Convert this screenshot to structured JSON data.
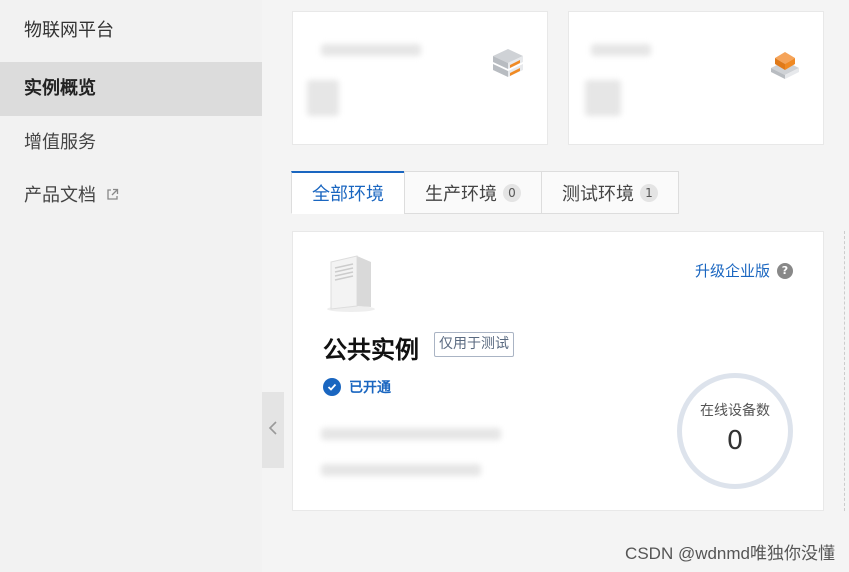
{
  "sidebar": {
    "title": "物联网平台",
    "items": [
      {
        "label": "实例概览",
        "active": true
      },
      {
        "label": "增值服务",
        "active": false
      },
      {
        "label": "产品文档",
        "active": false,
        "external": true
      }
    ]
  },
  "stat_cards": [
    {
      "icon": "orange-server-stack-icon"
    },
    {
      "icon": "orange-cube-stack-icon"
    }
  ],
  "tabs": [
    {
      "label": "全部环境",
      "active": true
    },
    {
      "label": "生产环境",
      "count": "0"
    },
    {
      "label": "测试环境",
      "count": "1"
    }
  ],
  "instance": {
    "title": "公共实例",
    "tag": "仅用于测试",
    "status": "已开通",
    "upgrade_label": "升级企业版",
    "help_glyph": "?",
    "online_devices_label": "在线设备数",
    "online_devices_value": "0"
  },
  "watermark": "CSDN @wdnmd唯独你没懂",
  "colors": {
    "accent": "#1a66c0",
    "icon_orange": "#f08a24",
    "sidebar_active": "#dcdcdc"
  }
}
